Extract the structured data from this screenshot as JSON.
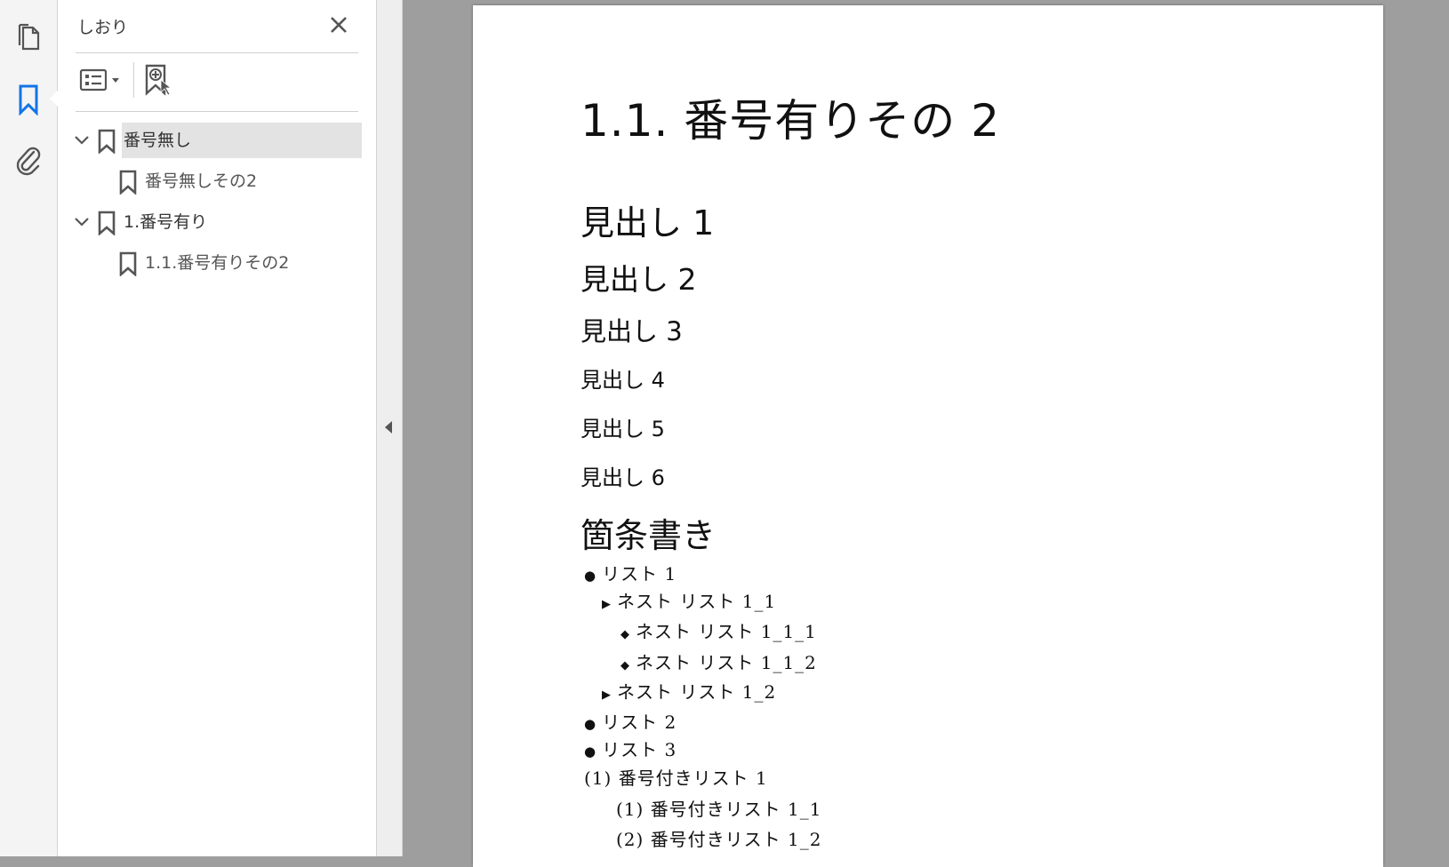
{
  "panel": {
    "title": "しおり",
    "bookmarks": [
      {
        "label": "番号無し",
        "level": 0,
        "expanded": true,
        "selected": true
      },
      {
        "label": "番号無しその2",
        "level": 1
      },
      {
        "label": "1.番号有り",
        "level": 0,
        "expanded": true
      },
      {
        "label": "1.1.番号有りその2",
        "level": 1
      }
    ]
  },
  "document": {
    "heading_main": "1.1.  番号有りその 2",
    "headings": [
      "見出し 1",
      "見出し 2",
      "見出し 3",
      "見出し 4",
      "見出し 5",
      "見出し 6"
    ],
    "list_heading": "箇条書き",
    "list_items": [
      {
        "marker": "●",
        "text": "リスト 1"
      },
      {
        "marker": "▶",
        "text": "ネスト リスト 1_1"
      },
      {
        "marker": "◆",
        "text": "ネスト リスト 1_1_1"
      },
      {
        "marker": "◆",
        "text": "ネスト リスト 1_1_2"
      },
      {
        "marker": "▶",
        "text": "ネスト リスト 1_2"
      },
      {
        "marker": "●",
        "text": "リスト 2"
      },
      {
        "marker": "●",
        "text": "リスト 3"
      },
      {
        "marker": "",
        "text": "(1) 番号付きリスト 1"
      },
      {
        "marker": "",
        "text": "(1) 番号付きリスト 1_1"
      },
      {
        "marker": "",
        "text": "(2) 番号付きリスト 1_2"
      }
    ]
  },
  "colors": {
    "accent": "#1473e6",
    "selected_row": "#e3e3e3",
    "canvas": "#9e9e9e"
  }
}
